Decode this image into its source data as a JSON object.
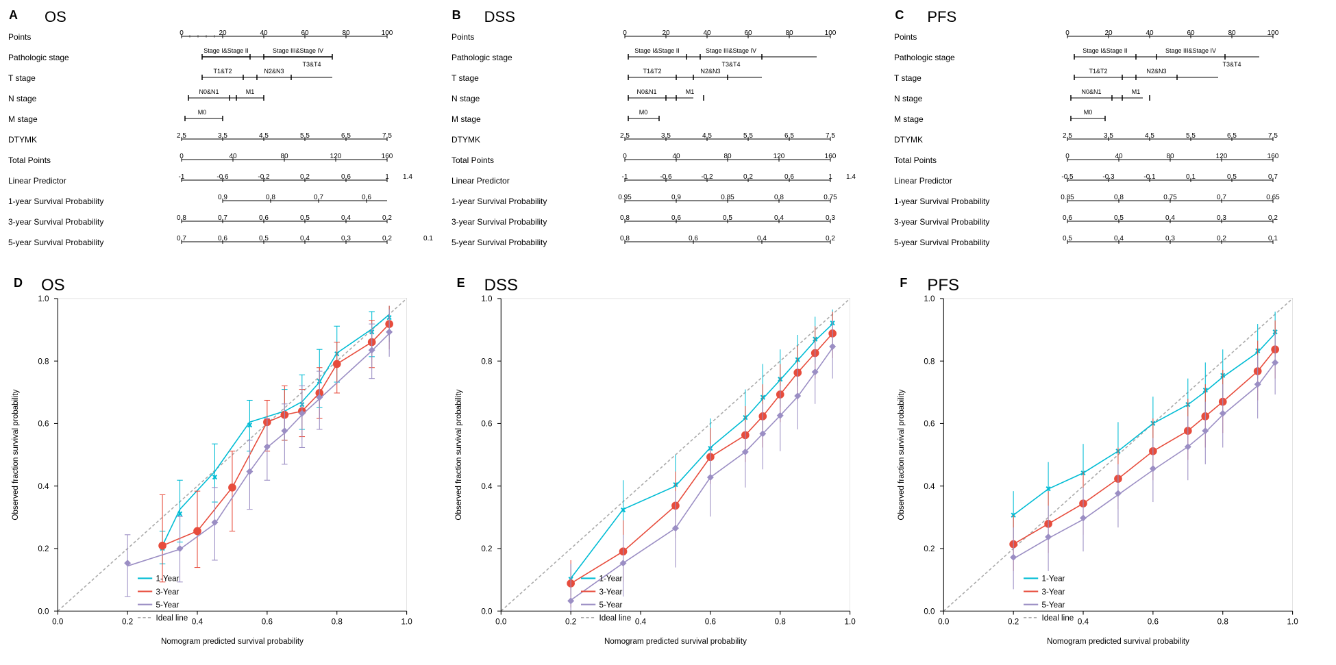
{
  "panels": {
    "A": {
      "label": "A",
      "title": "OS"
    },
    "B": {
      "label": "B",
      "title": "DSS"
    },
    "C": {
      "label": "C",
      "title": "PFS"
    },
    "D": {
      "label": "D",
      "title": "OS"
    },
    "E": {
      "label": "E",
      "title": "DSS"
    },
    "F": {
      "label": "F",
      "title": "PFS"
    }
  },
  "nomogram_rows": [
    "Points",
    "Pathologic stage",
    "T stage",
    "N stage",
    "M stage",
    "DTYMK",
    "Total Points",
    "Linear Predictor",
    "1-year Survival Probability",
    "3-year Survival Probability",
    "5-year Survival Probability"
  ],
  "calibration": {
    "legend": {
      "items": [
        {
          "label": "1-Year",
          "color": "#00bcd4"
        },
        {
          "label": "3-Year",
          "color": "#e74c3c"
        },
        {
          "label": "5-Year",
          "color": "#9b8ec4"
        },
        {
          "label": "Ideal line",
          "color": "#aaaaaa"
        }
      ]
    }
  }
}
